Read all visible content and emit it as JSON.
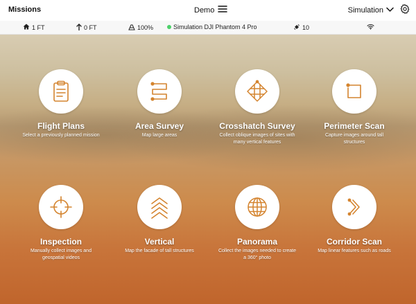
{
  "header": {
    "title": "Missions",
    "project": "Demo",
    "mode": "Simulation",
    "icons": [
      "hamburger-icon",
      "chevron-down-icon",
      "gear-icon"
    ]
  },
  "status": {
    "home_height": "1 FT",
    "altitude": "0 FT",
    "battery": "100%",
    "aircraft": "Simulation DJI Phantom 4 Pro",
    "aircraft_status_color": "#4cd06a",
    "satellites": "10",
    "icons": [
      "home-icon",
      "arrow-up-icon",
      "battery-icon",
      "satellite-icon",
      "wifi-icon"
    ]
  },
  "accent_color": "#d4842f",
  "cards": [
    {
      "title": "Flight Plans",
      "desc": "Select a previously planned mission",
      "icon": "clipboard-icon"
    },
    {
      "title": "Area Survey",
      "desc": "Map large areas",
      "icon": "area-survey-icon"
    },
    {
      "title": "Crosshatch Survey",
      "desc": "Collect oblique images of sites with many vertical features",
      "icon": "crosshatch-icon"
    },
    {
      "title": "Perimeter Scan",
      "desc": "Capture images around tall structures",
      "icon": "perimeter-icon"
    },
    {
      "title": "Inspection",
      "desc": "Manually collect images and geospatial videos",
      "icon": "crosshair-icon"
    },
    {
      "title": "Vertical",
      "desc": "Map the facade of tall structures",
      "icon": "chevrons-up-icon"
    },
    {
      "title": "Panorama",
      "desc": "Collect the images needed to create a 360° photo",
      "icon": "globe-icon"
    },
    {
      "title": "Corridor Scan",
      "desc": "Map linear features such as roads",
      "icon": "corridor-icon"
    }
  ]
}
